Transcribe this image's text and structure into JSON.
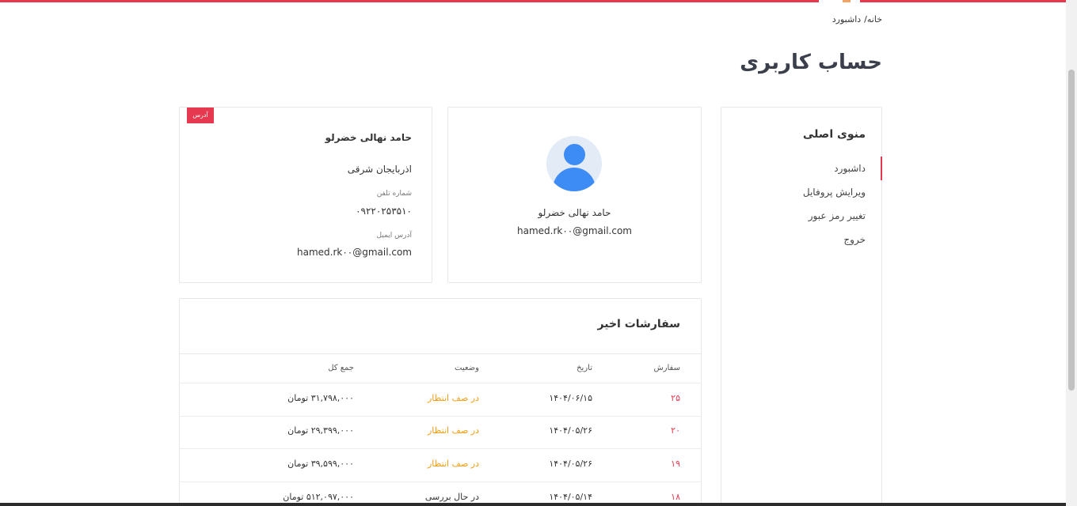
{
  "breadcrumb": {
    "home": "خانه/",
    "current": "داشبورد"
  },
  "page_title": "حساب کاربری",
  "menu": {
    "title": "منوی اصلی",
    "items": [
      {
        "label": "داشبورد",
        "active": true
      },
      {
        "label": "ویرایش پروفایل"
      },
      {
        "label": "تغییر رمز عبور"
      },
      {
        "label": "خروج"
      }
    ]
  },
  "profile": {
    "name": "حامد نهالی خضرلو",
    "email": "hamed.rk۰۰@gmail.com",
    "avatar_icon": "user-avatar-icon"
  },
  "address": {
    "badge": "آدرس",
    "name": "حامد نهالی خضرلو",
    "region": "اذربایجان شرقی",
    "phone_label": "شماره تلفن",
    "phone": "۰۹۲۲۰۲۵۳۵۱۰",
    "email_label": "آدرس ایمیل",
    "email": "hamed.rk۰۰@gmail.com"
  },
  "orders": {
    "title": "سفارشات اخیر",
    "headers": {
      "order": "سفارش",
      "date": "تاریخ",
      "status": "وضعیت",
      "total": "جمع کل"
    },
    "rows": [
      {
        "id": "۲۵",
        "date": "۱۴۰۴/۰۶/۱۵",
        "status": "در صف انتظار",
        "total": "۳۱,۷۹۸,۰۰۰ تومان"
      },
      {
        "id": "۲۰",
        "date": "۱۴۰۴/۰۵/۲۶",
        "status": "در صف انتظار",
        "total": "۲۹,۳۹۹,۰۰۰ تومان"
      },
      {
        "id": "۱۹",
        "date": "۱۴۰۴/۰۵/۲۶",
        "status": "در صف انتظار",
        "total": "۳۹,۵۹۹,۰۰۰ تومان"
      },
      {
        "id": "۱۸",
        "date": "۱۴۰۴/۰۵/۱۴",
        "status": "در حال بررسی",
        "total": "۵۱۲,۰۹۷,۰۰۰ تومان"
      }
    ]
  },
  "colors": {
    "accent": "#e6394f",
    "pending": "#f39c12",
    "avatar": "#3d8bf5"
  }
}
